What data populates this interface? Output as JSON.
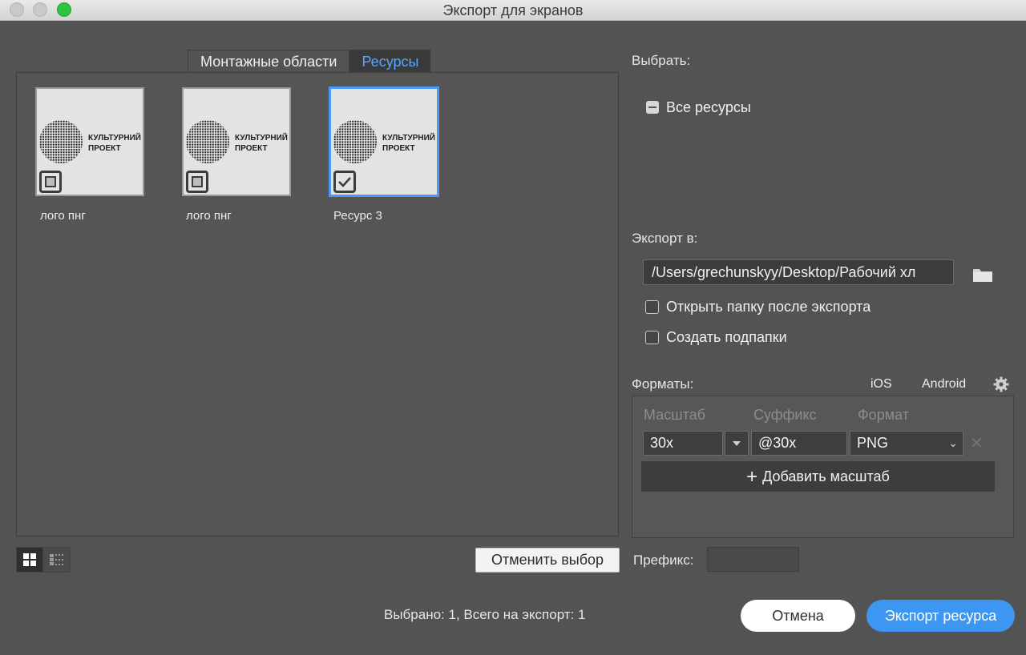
{
  "window": {
    "title": "Экспорт для экранов"
  },
  "tabs": [
    {
      "label": "Монтажные области",
      "active": false
    },
    {
      "label": "Ресурсы",
      "active": true
    }
  ],
  "assets": [
    {
      "name": "лого пнг",
      "selected": false,
      "logo_text": [
        "КУЛЬТУРНИЙ",
        "ПРОЕКТ"
      ]
    },
    {
      "name": "лого пнг",
      "selected": false,
      "logo_text": [
        "КУЛЬТУРНИЙ",
        "ПРОЕКТ"
      ]
    },
    {
      "name": "Ресурс 3",
      "selected": true,
      "logo_text": [
        "КУЛЬТУРНИЙ",
        "ПРОЕКТ"
      ]
    }
  ],
  "view_modes": [
    "grid-view-icon",
    "list-view-icon"
  ],
  "deselect_label": "Отменить выбор",
  "status_text": "Выбрано: 1, Всего на экспорт: 1",
  "select": {
    "heading": "Выбрать:",
    "all_assets_label": "Все ресурсы",
    "all_assets_state": "mixed"
  },
  "export_to": {
    "heading": "Экспорт в:",
    "path": "/Users/grechunskyy/Desktop/Рабочий хл",
    "open_folder_label": "Открыть папку после экспорта",
    "open_folder_checked": false,
    "create_subfolders_label": "Создать подпапки",
    "create_subfolders_checked": false
  },
  "formats": {
    "heading": "Форматы:",
    "ios_label": "iOS",
    "android_label": "Android",
    "col_scale": "Масштаб",
    "col_suffix": "Суффикс",
    "col_format": "Формат",
    "rows": [
      {
        "scale": "30x",
        "suffix": "@30x",
        "format": "PNG"
      }
    ],
    "add_scale_label": "Добавить масштаб"
  },
  "prefix": {
    "label": "Префикс:",
    "value": ""
  },
  "buttons": {
    "cancel": "Отмена",
    "export": "Экспорт ресурса"
  },
  "colors": {
    "accent": "#3d97f2",
    "background": "#535353",
    "tab_active_text": "#58a6ff"
  }
}
